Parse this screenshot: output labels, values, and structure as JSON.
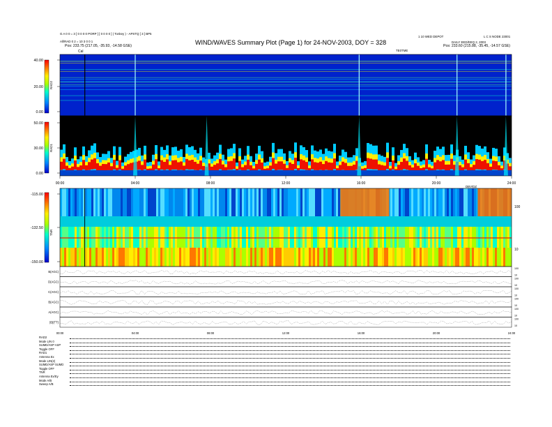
{
  "header": {
    "title": "WIND/WAVES Summary Plot (Page 1) for 24-NOV-2003, DOY = 328",
    "top_left_1": "G A 0 0 = 3 [ 0 0 0 0 PORP ] [ 0 0 0 0 ] ( Tonkey ) - APSTQ [ 3 ] BP5",
    "top_left_2": "All/RAD 0 2 = 10 3 0 0 1",
    "pos_left": "Pos:   233.75 (217.05, -35.93, -14.58 GSE)",
    "top_right_1": "1 10 WED DEPOT",
    "top_right_1b": "L C S NODE 23001",
    "top_right_2": "DAILY EED/EEQ 2, 2003",
    "pos_right": "Pos:   233.60 (215.88, -35.45, -14.57 GSE)",
    "time_mark": "TE0TME",
    "cal_label": "Cal"
  },
  "chart_data": [
    {
      "type": "heatmap",
      "panel": "RAD2",
      "ylabel": "RAD2",
      "y_ticks": [
        "40.00",
        "20.00",
        "0.00"
      ],
      "ylim": [
        0,
        40
      ],
      "colorbar": "rainbow"
    },
    {
      "type": "heatmap",
      "panel": "RAD1",
      "ylabel": "RAD1",
      "y_ticks": [
        "50.00",
        "30.00",
        "0.00"
      ],
      "ylim": [
        0,
        50
      ],
      "colorbar": "rainbow",
      "x_ticks": [
        "00:00",
        "04:00",
        "08:00",
        "12:00",
        "16:00",
        "20:00",
        "24:00"
      ]
    },
    {
      "type": "heatmap",
      "panel": "TNR",
      "ylabel": "TNR",
      "y_ticks": [
        "-115.00",
        "-132.50",
        "-150.00"
      ],
      "ylim": [
        -150,
        -115
      ],
      "right_ticks": [
        "100",
        "10"
      ],
      "colorbar": "rainbow",
      "top_right_label": "DBV/DZ"
    },
    {
      "type": "line",
      "panel": "monitor",
      "rows": [
        "B(AGC)",
        "D(AGC)",
        "C(AGC)",
        "B(AGC)",
        "A(AGC)",
        "|B|(TT)"
      ],
      "right_ticks": [
        "100",
        "10"
      ],
      "x_ticks": [
        "00:00",
        "04:00",
        "08:00",
        "12:00",
        "16:00",
        "20:00",
        "24:00"
      ]
    }
  ],
  "footer": {
    "rows": [
      {
        "k": "RAD2",
        "v": ""
      },
      {
        "k": "Mode",
        "v": "LIN 0"
      },
      {
        "k": "SUMD/ASP",
        "v": "ASP"
      },
      {
        "k": "Toggle",
        "v": "OFF"
      },
      {
        "k": "RAD1",
        "v": ""
      },
      {
        "k": "Antenna",
        "v": "Ex"
      },
      {
        "k": "Mode",
        "v": "LIN(2)"
      },
      {
        "k": "SUMD/ASP",
        "v": "SUMD"
      },
      {
        "k": "Toggle",
        "v": "OFF"
      },
      {
        "k": "TNR",
        "v": ""
      },
      {
        "k": "Antenna",
        "v": "Ex/Ey"
      },
      {
        "k": "Mode",
        "v": "A/B"
      },
      {
        "k": "Sweep",
        "v": "A/B"
      }
    ]
  },
  "colors": {
    "background": "#ffffff",
    "rad2_bg": "#0022cc",
    "rad1_bg": "#000000",
    "hot": "#ee1100"
  }
}
